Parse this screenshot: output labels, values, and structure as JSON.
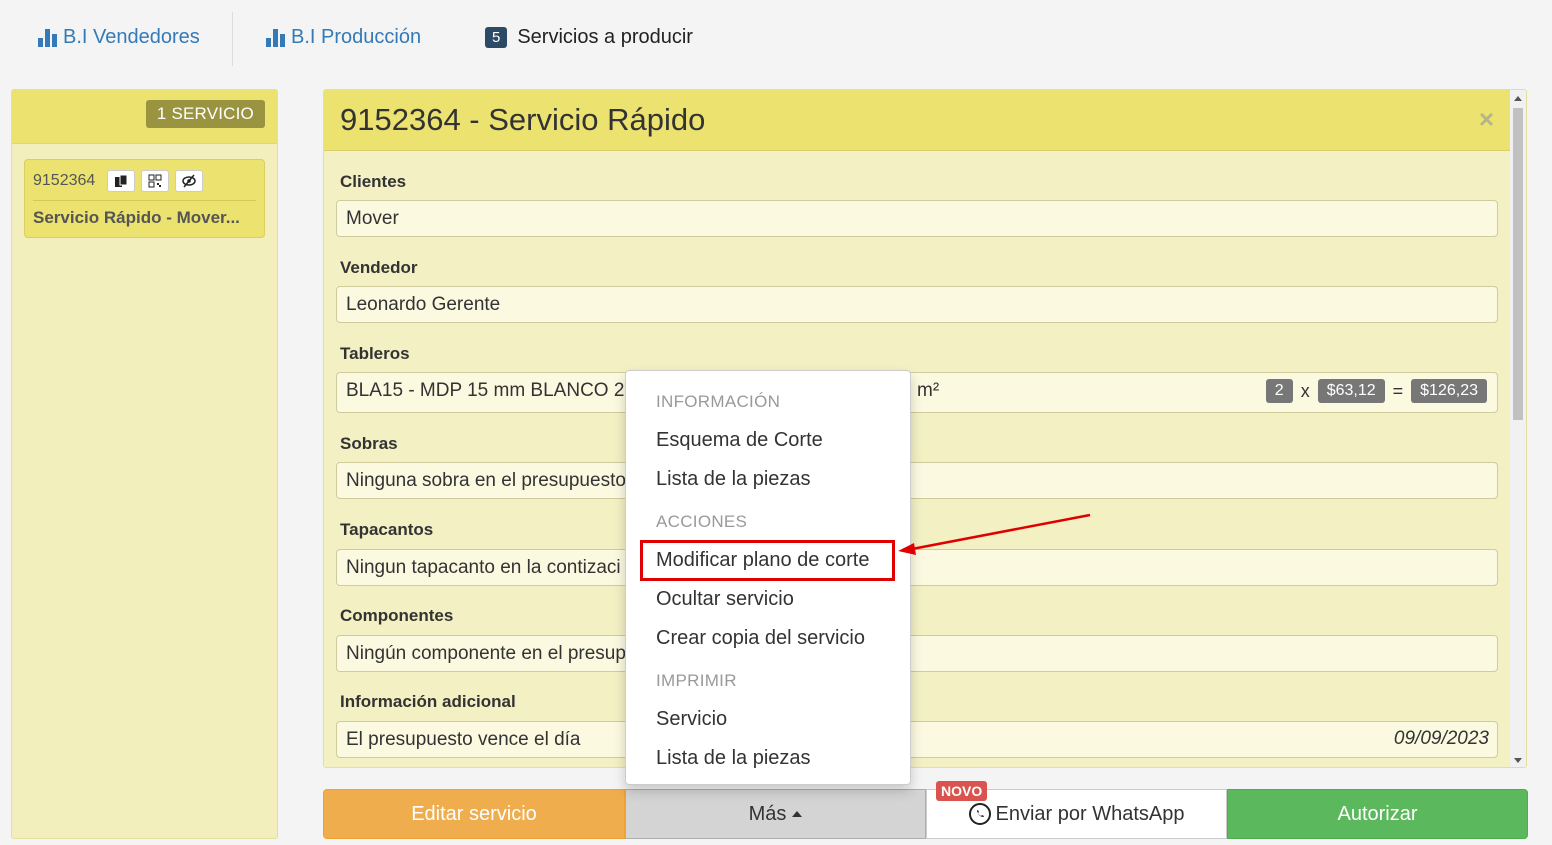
{
  "nav": {
    "bi_vendedores": "B.I Vendedores",
    "bi_produccion": "B.I Producción",
    "servicios_count": "5",
    "servicios_label": "Servicios a producir"
  },
  "left": {
    "count_badge": "1 SERVICIO",
    "card": {
      "number": "9152364",
      "title": "Servicio Rápido - Mover..."
    }
  },
  "main": {
    "title": "9152364 - Servicio Rápido",
    "fields": {
      "clientes_label": "Clientes",
      "clientes_value": "Mover",
      "vendedor_label": "Vendedor",
      "vendedor_value": "Leonardo Gerente",
      "tableros_label": "Tableros",
      "tableros_value": "BLA15 - MDP 15 mm BLANCO 2",
      "tableros_unit": "m²",
      "tableros_qty": "2",
      "tableros_x": "x",
      "tableros_price": "$63,12",
      "tableros_eq": "=",
      "tableros_total": "$126,23",
      "sobras_label": "Sobras",
      "sobras_value": "Ninguna sobra en el presupuesto",
      "tapacantos_label": "Tapacantos",
      "tapacantos_value": "Ningun tapacanto en la contizaci",
      "componentes_label": "Componentes",
      "componentes_value": "Ningún componente en el presup",
      "info_label": "Información adicional",
      "info_value": "El presupuesto vence el día",
      "info_date": "09/09/2023"
    }
  },
  "dropdown": {
    "header_info": "INFORMACIÓN",
    "esquema": "Esquema de Corte",
    "lista1": "Lista de la piezas",
    "header_acciones": "ACCIONES",
    "modificar": "Modificar plano de corte",
    "ocultar": "Ocultar servicio",
    "copia": "Crear copia del servicio",
    "header_imprimir": "IMPRIMIR",
    "servicio": "Servicio",
    "lista2": "Lista de la piezas"
  },
  "buttons": {
    "editar": "Editar servicio",
    "mas": "Más",
    "novo": "NOVO",
    "whatsapp": "Enviar por WhatsApp",
    "autorizar": "Autorizar"
  },
  "colors": {
    "panel_yellow": "#ece270",
    "annotation_red": "#e00000",
    "link_blue": "#337ab7"
  }
}
